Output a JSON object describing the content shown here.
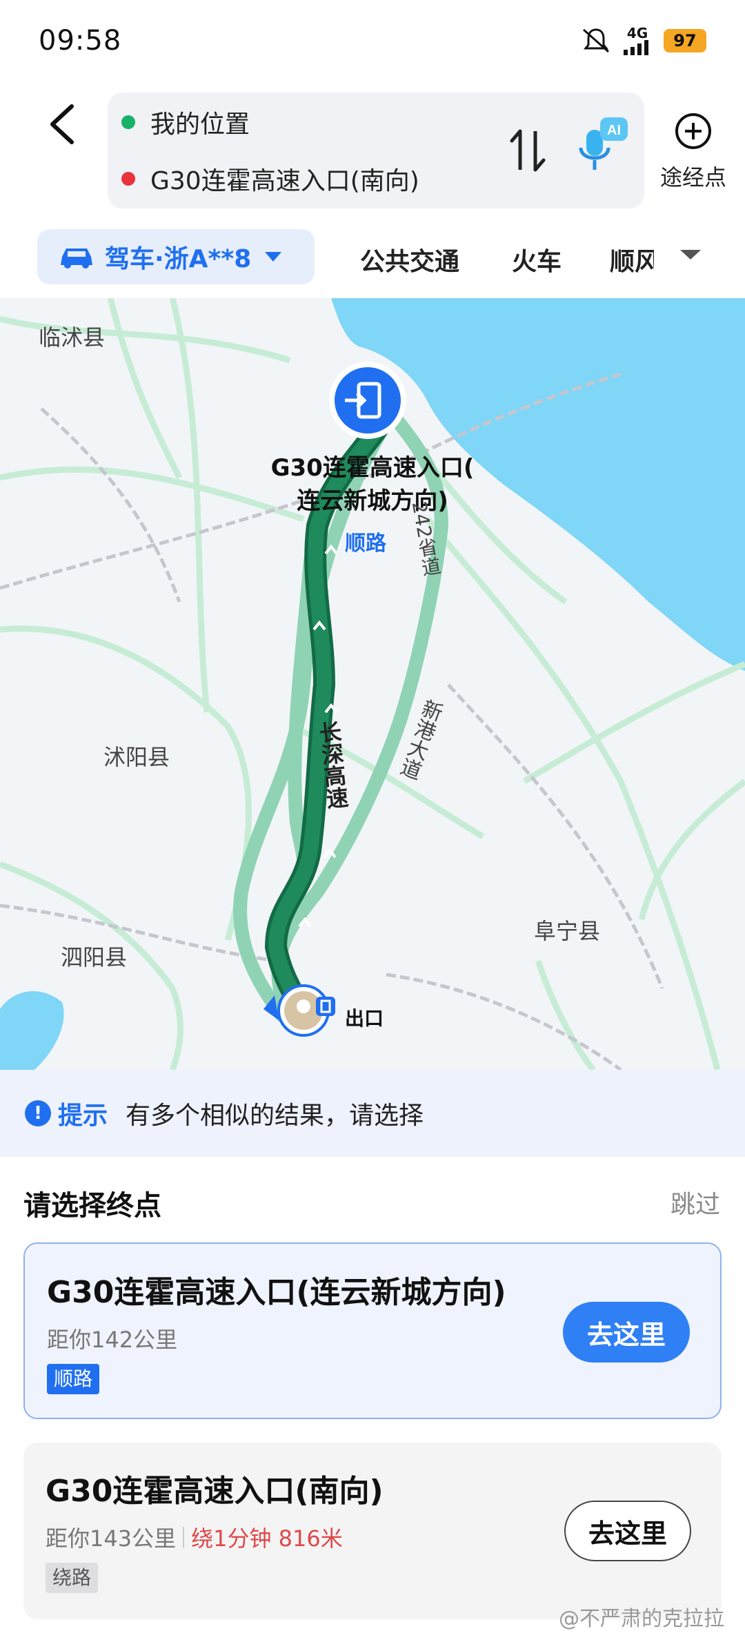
{
  "status_bar": {
    "time": "09:58",
    "network": "4G",
    "battery": "97"
  },
  "route": {
    "origin": "我的位置",
    "destination": "G30连霍高速入口(南向)",
    "waypoint_label": "途经点",
    "origin_color": "#17b26a",
    "destination_color": "#e8323c"
  },
  "modes": {
    "drive": "驾车·浙A**8",
    "transit": "公共交通",
    "train": "火车",
    "ride": "顺风"
  },
  "map": {
    "places": [
      "临沭县",
      "沭阳县",
      "泗阳县",
      "阜宁县"
    ],
    "roads": [
      "长深高速",
      "新港大道",
      "242省道"
    ],
    "destination_name_line1": "G30连霍高速入口(",
    "destination_name_line2": "连云新城方向)",
    "destination_tag": "顺路",
    "exit_label": "出口"
  },
  "tip": {
    "label": "提示",
    "text": "有多个相似的结果，请选择"
  },
  "sheet": {
    "title": "请选择终点",
    "skip": "跳过",
    "options": [
      {
        "name": "G30连霍高速入口(连云新城方向)",
        "distance": "距你142公里",
        "extra": "",
        "tag": "顺路",
        "button": "去这里"
      },
      {
        "name": "G30连霍高速入口(南向)",
        "distance": "距你143公里",
        "extra": "绕1分钟 816米",
        "tag": "绕路",
        "button": "去这里"
      }
    ]
  },
  "watermark": "@不严肃的克拉拉",
  "colors": {
    "accent": "#1f6ff0",
    "route_main": "#1f8a5b",
    "route_alt": "#8fd3b4",
    "sea": "#7fd6f6"
  }
}
